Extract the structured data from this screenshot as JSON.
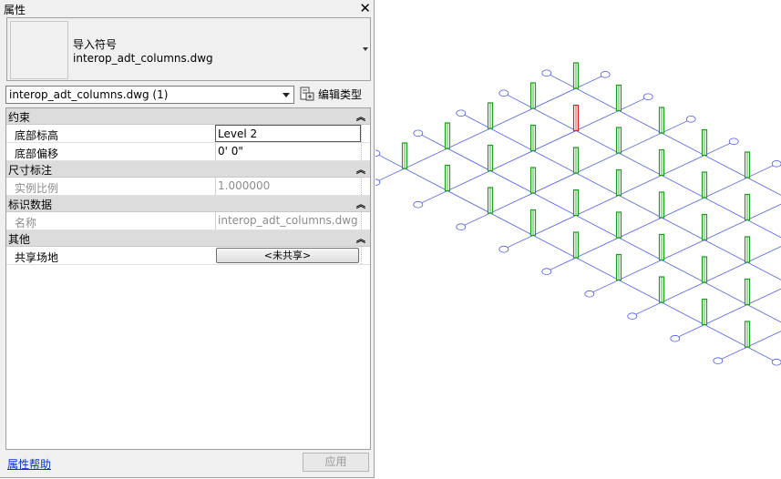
{
  "panel": {
    "title": "属性",
    "close_label": "✕"
  },
  "type_selector": {
    "family": "导入符号",
    "type_name": "interop_adt_columns.dwg"
  },
  "instance_selector": {
    "label": "interop_adt_columns.dwg (1)"
  },
  "edit_type": {
    "label": "编辑类型"
  },
  "groups": [
    {
      "name": "约束",
      "rows": [
        {
          "name": "底部标高",
          "value": "Level 2"
        },
        {
          "name": "底部偏移",
          "value": "0'  0\""
        }
      ]
    },
    {
      "name": "尺寸标注",
      "rows": [
        {
          "name": "实例比例",
          "value": "1.000000"
        }
      ]
    },
    {
      "name": "标识数据",
      "rows": [
        {
          "name": "名称",
          "value": "interop_adt_columns.dwg"
        }
      ]
    },
    {
      "name": "其他",
      "rows": [
        {
          "name": "共享场地",
          "value": "<未共享>"
        }
      ]
    }
  ],
  "footer": {
    "help_link": "属性帮助",
    "apply_label": "应用"
  },
  "colors": {
    "panel_bg": "#f0f0f0",
    "group_bg": "#dcdcdc",
    "grid_line": "#4b5ce6",
    "column_green": "#1a9e1a",
    "column_selected": "#e02020",
    "link": "#0033cc"
  },
  "icons": {
    "close": "close-icon",
    "edit_type": "edit-type-icon",
    "group_toggle": "collapse-chevron-icon",
    "dropdown": "chevron-down-icon"
  }
}
